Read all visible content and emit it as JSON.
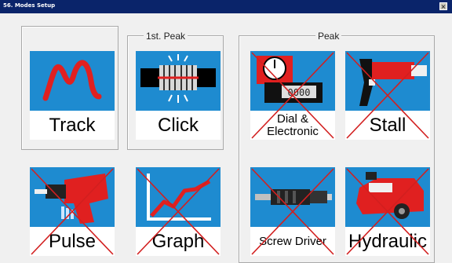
{
  "window": {
    "title": "56. Modes Setup",
    "close_glyph": "×"
  },
  "groups": {
    "first_peak": {
      "label": "1st. Peak"
    },
    "peak": {
      "label": "Peak"
    }
  },
  "tiles": {
    "track": {
      "label": "Track",
      "disabled": false
    },
    "click": {
      "label": "Click",
      "disabled": false
    },
    "dial_electronic": {
      "label": "Dial & Electronic",
      "disabled": true
    },
    "stall": {
      "label": "Stall",
      "disabled": true
    },
    "pulse": {
      "label": "Pulse",
      "disabled": true
    },
    "graph": {
      "label": "Graph",
      "disabled": true
    },
    "screw_driver": {
      "label": "Screw Driver",
      "disabled": true
    },
    "hydraulic": {
      "label": "Hydraulic",
      "disabled": true
    }
  },
  "dial_screen_text": "0000",
  "colors": {
    "tile_bg": "#1e8bd0",
    "tool_red": "#e02020",
    "cross_red": "#d21f1f",
    "titlebar": "#0a246a"
  }
}
